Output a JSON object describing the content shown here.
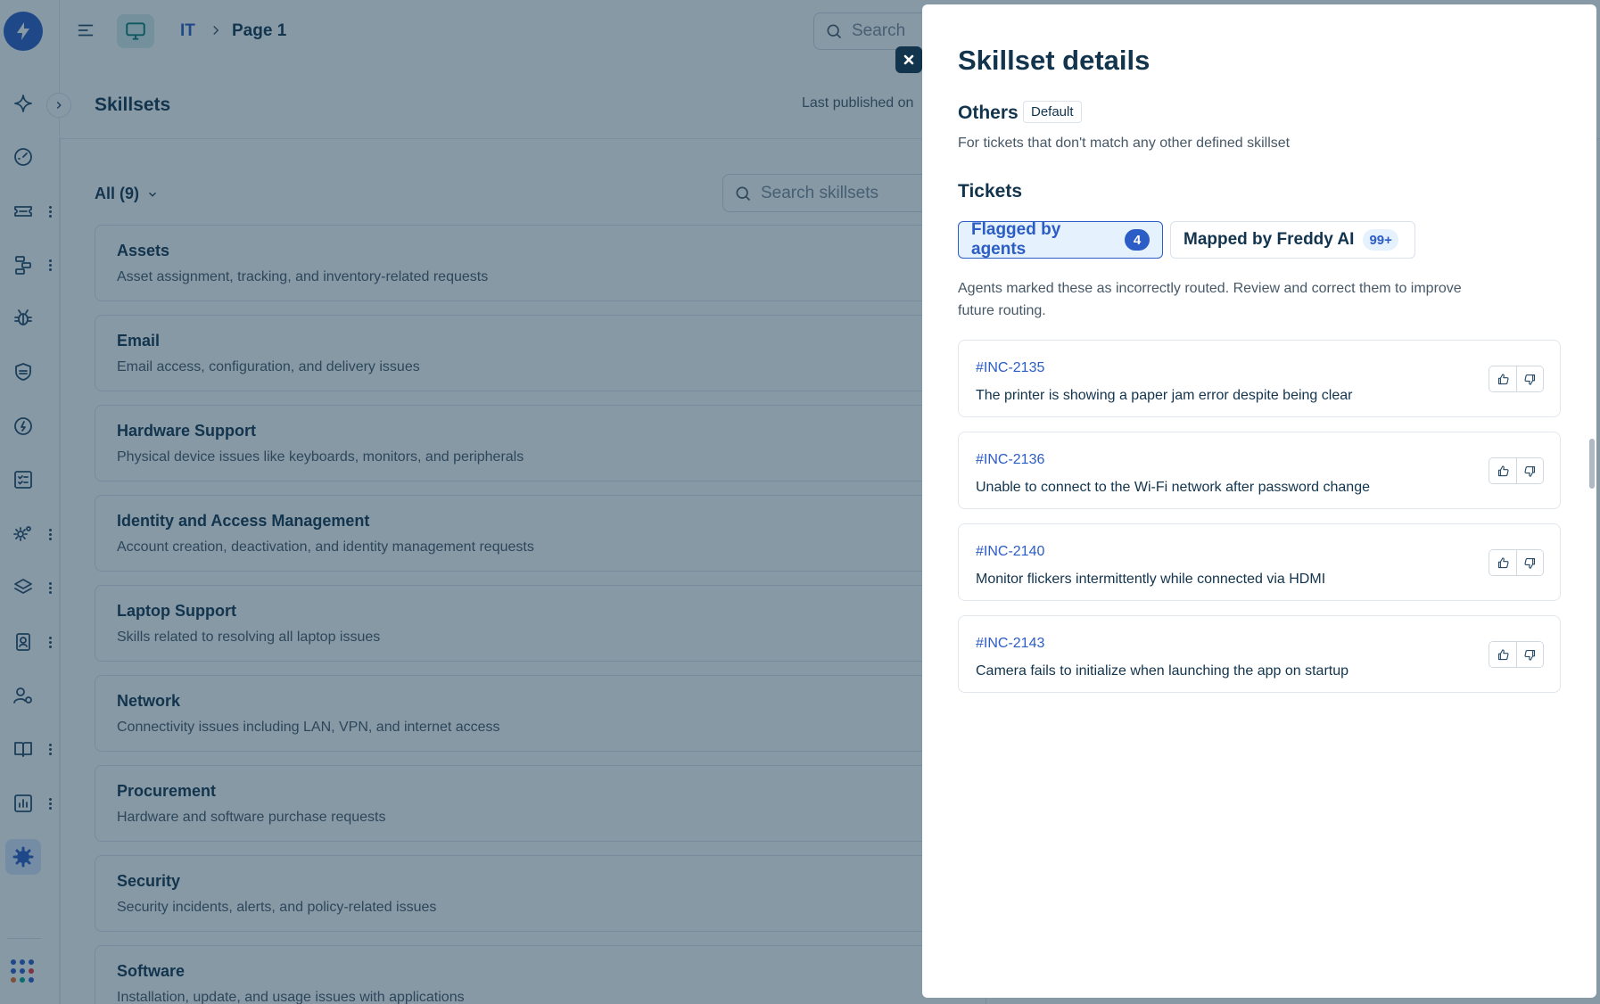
{
  "topbar": {
    "breadcrumb_root": "IT",
    "breadcrumb_page": "Page 1",
    "search_placeholder": "Search"
  },
  "page": {
    "title": "Skillsets",
    "published": "Last published on",
    "filter_label": "All (9)",
    "search_placeholder": "Search skillsets"
  },
  "skillsets": [
    {
      "name": "Assets",
      "desc": "Asset assignment, tracking, and inventory-related requests"
    },
    {
      "name": "Email",
      "desc": "Email access, configuration, and delivery issues"
    },
    {
      "name": "Hardware Support",
      "desc": "Physical device issues like keyboards, monitors, and peripherals"
    },
    {
      "name": "Identity and Access Management",
      "desc": "Account creation, deactivation, and identity management requests"
    },
    {
      "name": "Laptop Support",
      "desc": "Skills related to resolving all laptop issues"
    },
    {
      "name": "Network",
      "desc": "Connectivity issues including LAN, VPN, and internet access"
    },
    {
      "name": "Procurement",
      "desc": "Hardware and software purchase requests"
    },
    {
      "name": "Security",
      "desc": "Security incidents, alerts, and policy-related issues"
    },
    {
      "name": "Software",
      "desc": "Installation, update, and usage issues with applications"
    }
  ],
  "drawer": {
    "title": "Skillset details",
    "skill_name": "Others",
    "badge": "Default",
    "skill_desc": "For tickets that don't match any other defined skillset",
    "tickets_heading": "Tickets",
    "tabs": [
      {
        "label": "Flagged by agents",
        "count": "4"
      },
      {
        "label": "Mapped by Freddy AI",
        "count": "99+"
      }
    ],
    "helper": "Agents marked these as incorrectly routed. Review and correct them to improve future routing.",
    "tickets": [
      {
        "id": "#INC-2135",
        "text": "The printer is showing a paper jam error despite being clear"
      },
      {
        "id": "#INC-2136",
        "text": "Unable to connect to the Wi-Fi network after password change"
      },
      {
        "id": "#INC-2140",
        "text": "Monitor flickers intermittently while connected via HDMI"
      },
      {
        "id": "#INC-2143",
        "text": "Camera fails to initialize when launching the app on startup"
      }
    ]
  },
  "colors": {
    "primary": "#2c5cc5",
    "text": "#12344d",
    "muted": "#475867",
    "overlay": "rgba(18,52,77,0.5)"
  },
  "icons": {
    "rail": [
      "freddy-logo-icon",
      "sparkle-icon",
      "dashboard-icon",
      "ticket-icon",
      "workflow-icon",
      "bug-icon",
      "shield-icon",
      "speed-icon",
      "checklist-icon",
      "settings-gears-icon",
      "layers-icon",
      "contact-icon",
      "user-status-icon",
      "book-icon",
      "report-icon",
      "gear-icon",
      "apps-grid-icon"
    ]
  }
}
